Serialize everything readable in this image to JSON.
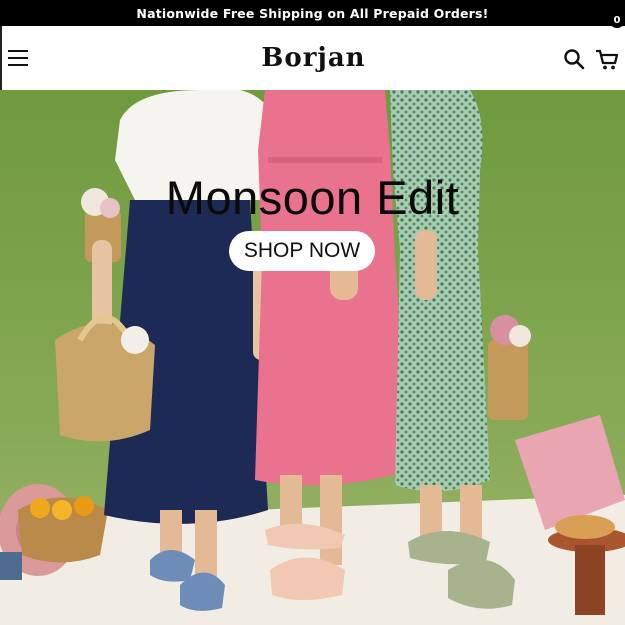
{
  "announcement": {
    "text": "Nationwide Free Shipping on All Prepaid Orders!"
  },
  "header": {
    "logo": "Borjan",
    "menu_icon": "hamburger-menu-icon",
    "search_icon": "search-icon",
    "cart_icon": "cart-icon",
    "cart_count": "0"
  },
  "hero": {
    "title": "Monsoon Edit",
    "cta_label": "SHOP NOW"
  },
  "colors": {
    "announcement_bg": "#000000",
    "grass": "#7fa14b",
    "pink_dress": "#e9738e",
    "navy_skirt": "#1d2a55",
    "green_dress": "#8fb89a"
  }
}
